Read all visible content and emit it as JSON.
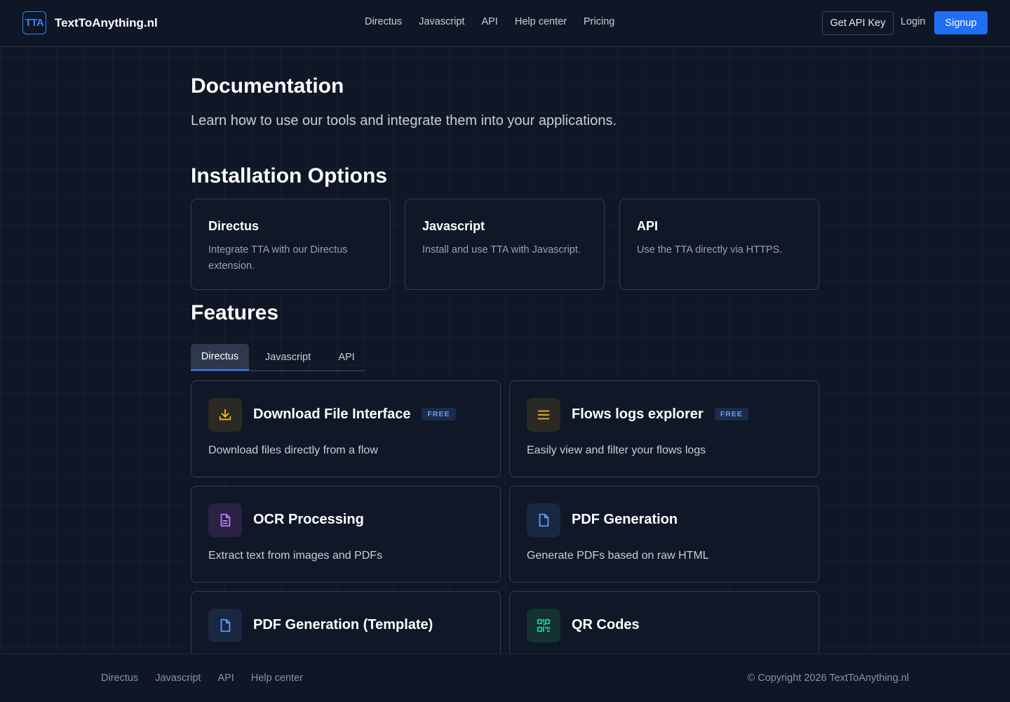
{
  "header": {
    "logo_text": "TTA",
    "brand": "TextToAnything.nl",
    "nav": [
      "Directus",
      "Javascript",
      "API",
      "Help center",
      "Pricing"
    ],
    "get_api_key": "Get API Key",
    "login": "Login",
    "signup": "Signup"
  },
  "main": {
    "title": "Documentation",
    "lead": "Learn how to use our tools and integrate them into your applications.",
    "installation_heading": "Installation Options",
    "installation_options": [
      {
        "title": "Directus",
        "desc": "Integrate TTA with our Directus extension."
      },
      {
        "title": "Javascript",
        "desc": "Install and use TTA with Javascript."
      },
      {
        "title": "API",
        "desc": "Use the TTA directly via HTTPS."
      }
    ],
    "features_heading": "Features",
    "tabs": [
      "Directus",
      "Javascript",
      "API"
    ],
    "active_tab": "Directus",
    "features": [
      {
        "title": "Download File Interface",
        "badge": "FREE",
        "desc": "Download files directly from a flow",
        "icon": "download-icon",
        "color": "#f5b729"
      },
      {
        "title": "Flows logs explorer",
        "badge": "FREE",
        "desc": "Easily view and filter your flows logs",
        "icon": "list-icon",
        "color": "#f5b729"
      },
      {
        "title": "OCR Processing",
        "badge": "",
        "desc": "Extract text from images and PDFs",
        "icon": "document-text-icon",
        "color": "#b57cf0"
      },
      {
        "title": "PDF Generation",
        "badge": "",
        "desc": "Generate PDFs based on raw HTML",
        "icon": "file-icon",
        "color": "#5b9cf5"
      },
      {
        "title": "PDF Generation (Template)",
        "badge": "",
        "desc": "",
        "icon": "file-icon",
        "color": "#5b9cf5"
      },
      {
        "title": "QR Codes",
        "badge": "",
        "desc": "",
        "icon": "qr-code-icon",
        "color": "#2fc49a"
      }
    ]
  },
  "footer": {
    "links": [
      "Directus",
      "Javascript",
      "API",
      "Help center"
    ],
    "copyright": "© Copyright 2026 TextToAnything.nl"
  }
}
